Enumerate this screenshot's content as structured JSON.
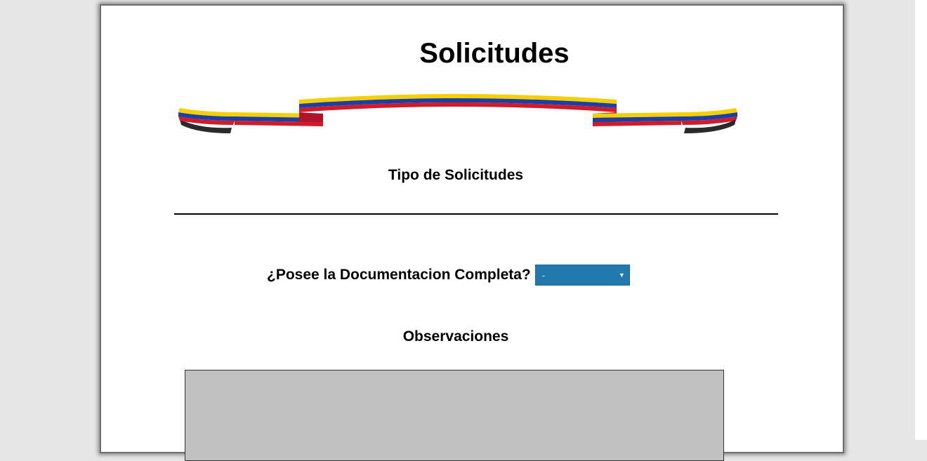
{
  "page": {
    "title": "Solicitudes",
    "subtitle": "Tipo de Solicitudes"
  },
  "documentation": {
    "label": "¿Posee la Documentacion Completa?",
    "selected_value": "-",
    "options": [
      "-"
    ],
    "select_color": "#2179ad"
  },
  "observations": {
    "label": "Observaciones",
    "value": "",
    "background_color": "#c1c1c1"
  },
  "ribbon": {
    "icon": "flag-ribbon-icon",
    "colors": [
      "#f5d000",
      "#1a3fa8",
      "#d01c2a"
    ]
  }
}
